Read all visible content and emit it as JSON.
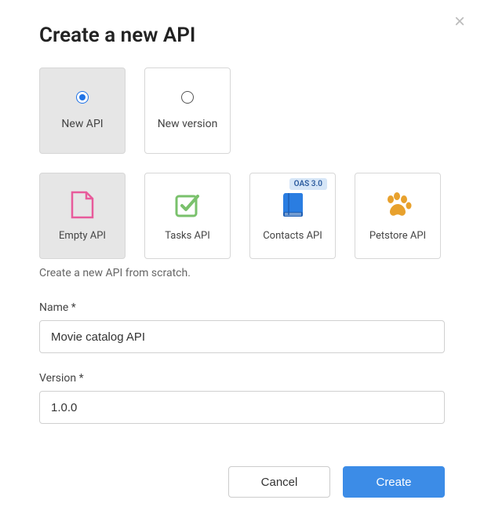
{
  "dialog": {
    "title": "Create a new API",
    "helper": "Create a new API from scratch.",
    "type_options": {
      "new_api": "New API",
      "new_version": "New version"
    },
    "templates": {
      "empty": "Empty API",
      "tasks": "Tasks API",
      "contacts": "Contacts API",
      "contacts_badge": "OAS 3.0",
      "petstore": "Petstore API"
    },
    "fields": {
      "name_label": "Name *",
      "name_value": "Movie catalog API",
      "version_label": "Version *",
      "version_value": "1.0.0"
    },
    "buttons": {
      "cancel": "Cancel",
      "create": "Create"
    }
  }
}
